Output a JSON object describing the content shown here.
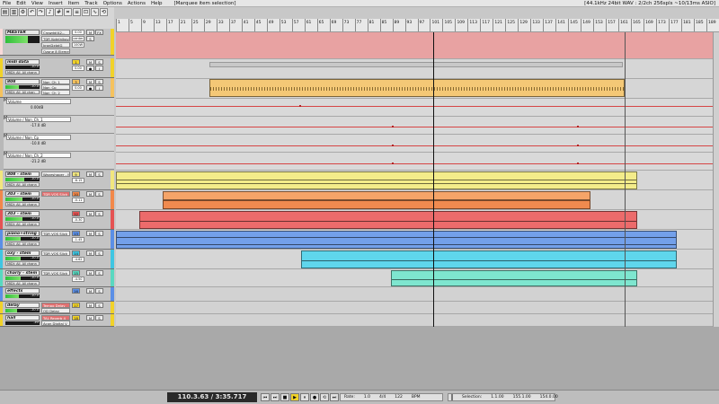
{
  "menu": {
    "items": [
      "File",
      "Edit",
      "View",
      "Insert",
      "Item",
      "Track",
      "Options",
      "Actions",
      "Help"
    ],
    "status": "[Marquee item selection]",
    "audio_info": "[44.1kHz 24bit WAV : 2/2ch 256spls ~10/13ms ASIO]"
  },
  "ruler": {
    "labels": [
      "1",
      "5",
      "9",
      "13",
      "17",
      "21",
      "25",
      "29",
      "33",
      "37",
      "41",
      "45",
      "49",
      "53",
      "57",
      "61",
      "65",
      "69",
      "73",
      "77",
      "81",
      "85",
      "89",
      "93",
      "97",
      "101",
      "105",
      "109",
      "113",
      "117",
      "121",
      "125",
      "129",
      "133",
      "137",
      "141",
      "145",
      "149",
      "153",
      "157",
      "161",
      "165",
      "169",
      "173",
      "177",
      "181",
      "185",
      "189"
    ]
  },
  "master": {
    "name": "MASTER",
    "fx": [
      "Crowdd(A2...",
      "TDR Kotelnikov",
      "kronDxtalG",
      "Ozone 8 Eleme"
    ],
    "vol": "0.00",
    "pan": "center",
    "width": "100W",
    "color": "#f9d9d9"
  },
  "tracks": [
    {
      "name": "midi data",
      "db": "-10.0",
      "midi": "MIDI: All, All chann",
      "fx": [],
      "vol": "0.00",
      "num": "1",
      "color": "#f1d229"
    },
    {
      "name": "808",
      "db": "-10.0",
      "midi": "MIDI: All, All chan",
      "fx": [
        "Non_Ch_1",
        "Non_Cp",
        "Non_Ch_2"
      ],
      "vol": "0.00",
      "num": "3",
      "color": "#f5c25e"
    },
    {
      "name": "808 - stem",
      "db": "-10.0",
      "midi": "MIDI: All, All chann",
      "fx": [
        "Waveshaper - M"
      ],
      "vol": "-6.15",
      "num": "9",
      "color": "#f1e67e"
    },
    {
      "name": "303 - stem",
      "db": "-10.0",
      "midi": "MIDI: All, All chann",
      "fx": [
        "TDR VOS Slick"
      ],
      "vol": "-0.11",
      "num": "10",
      "color": "#f2884a"
    },
    {
      "name": "303 - stem",
      "db": "-10.0",
      "midi": "MIDI: All, All chann",
      "fx": [],
      "vol": "-0.30",
      "num": "12",
      "color": "#e55353"
    },
    {
      "name": "piano+string - ",
      "db": "-10.0",
      "midi": "MIDI: All, All chann",
      "fx": [
        "TDR VOS Slick"
      ],
      "vol": "-1.45",
      "num": "13",
      "color": "#5b8fe6"
    },
    {
      "name": "oxy - stem",
      "db": "-10.0",
      "midi": "MIDI: All, All chann",
      "fx": [
        "TDR VOS Slick"
      ],
      "vol": "-4.62",
      "num": "14",
      "color": "#3fc6e2"
    },
    {
      "name": "charly - stem",
      "db": "-10.0",
      "midi": "MIDI: All, All chann",
      "fx": [
        "TDR VOS Slick"
      ],
      "vol": "-4.50",
      "num": "15",
      "color": "#59d8c0"
    },
    {
      "name": "effects",
      "db": "-10.0",
      "midi": "",
      "fx": [],
      "vol": "0.00",
      "num": "16",
      "color": "#5b8fe6"
    },
    {
      "name": "delay",
      "db": "-10.0",
      "midi": "",
      "fx": [
        "Tempo Delay",
        "OD Delay"
      ],
      "vol": "0.00",
      "num": "17",
      "color": "#f1d229"
    },
    {
      "name": "hall",
      "db": "-inf",
      "midi": "",
      "fx": [
        "TAL Reverb 4",
        "Acon Digital V"
      ],
      "vol": "0.00",
      "num": "18",
      "color": "#f1d229"
    }
  ],
  "envelopes": [
    {
      "name": "Volume",
      "value": "0.00dB"
    },
    {
      "name": "Volume / Non_Ch_1",
      "value": "-17.0 dB"
    },
    {
      "name": "Volume / Non_Cp",
      "value": "-10.0 dB"
    },
    {
      "name": "Volume / Non_Ch_2",
      "value": "-21.2 dB"
    }
  ],
  "buttons": {
    "mute": "M",
    "solo": "S",
    "rec": "●",
    "io": "I",
    "env": "E",
    "fx": "FX"
  },
  "transport": {
    "time": "110.3.63 / 3:35.717",
    "buttons": [
      "⏮",
      "⏭",
      "■",
      "▶",
      "⏸",
      "●",
      "⟲",
      "⏭"
    ],
    "rate_label": "Rate:",
    "rate": "1.0",
    "sig": "4/4",
    "bpm": "122",
    "bpm_label": "BPM",
    "sel_label": "Selection:",
    "sel_start": "1.1.00",
    "sel_end": "155.1.00",
    "sel_len": "154.0.00"
  }
}
